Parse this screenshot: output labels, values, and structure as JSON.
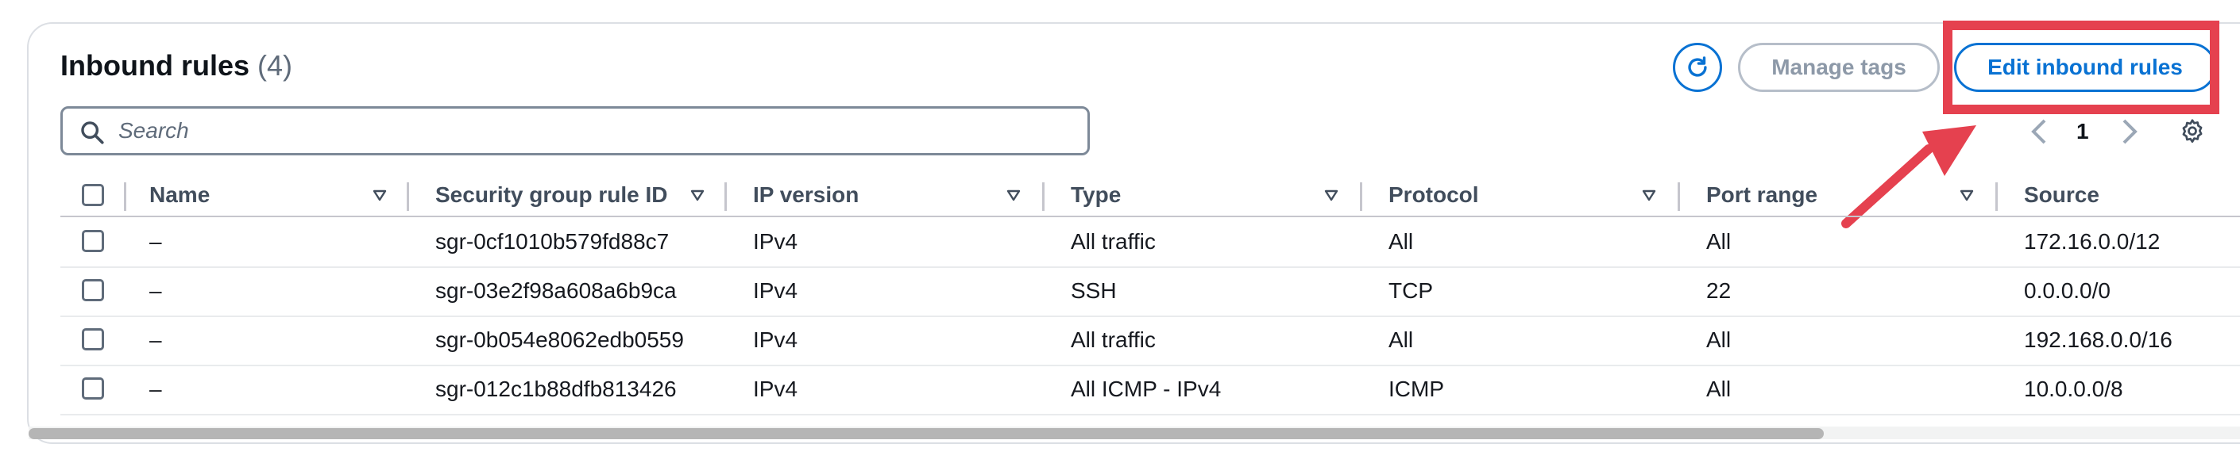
{
  "header": {
    "title": "Inbound rules",
    "count": "(4)",
    "buttons": {
      "refresh_icon": "refresh-icon",
      "manage_tags": "Manage tags",
      "edit_inbound_rules": "Edit inbound rules"
    }
  },
  "search": {
    "placeholder": "Search",
    "value": ""
  },
  "pagination": {
    "current_page": "1"
  },
  "table": {
    "columns": [
      "Name",
      "Security group rule ID",
      "IP version",
      "Type",
      "Protocol",
      "Port range",
      "Source"
    ],
    "rows": [
      {
        "name": "–",
        "rule_id": "sgr-0cf1010b579fd88c7",
        "ip_version": "IPv4",
        "type": "All traffic",
        "protocol": "All",
        "port_range": "All",
        "source": "172.16.0.0/12"
      },
      {
        "name": "–",
        "rule_id": "sgr-03e2f98a608a6b9ca",
        "ip_version": "IPv4",
        "type": "SSH",
        "protocol": "TCP",
        "port_range": "22",
        "source": "0.0.0.0/0"
      },
      {
        "name": "–",
        "rule_id": "sgr-0b054e8062edb0559",
        "ip_version": "IPv4",
        "type": "All traffic",
        "protocol": "All",
        "port_range": "All",
        "source": "192.168.0.0/16"
      },
      {
        "name": "–",
        "rule_id": "sgr-012c1b88dfb813426",
        "ip_version": "IPv4",
        "type": "All ICMP - IPv4",
        "protocol": "ICMP",
        "port_range": "All",
        "source": "10.0.0.0/8"
      }
    ]
  },
  "colors": {
    "accent": "#0972d3",
    "annotation": "#e5414f",
    "disabled": "#8d99a8"
  }
}
